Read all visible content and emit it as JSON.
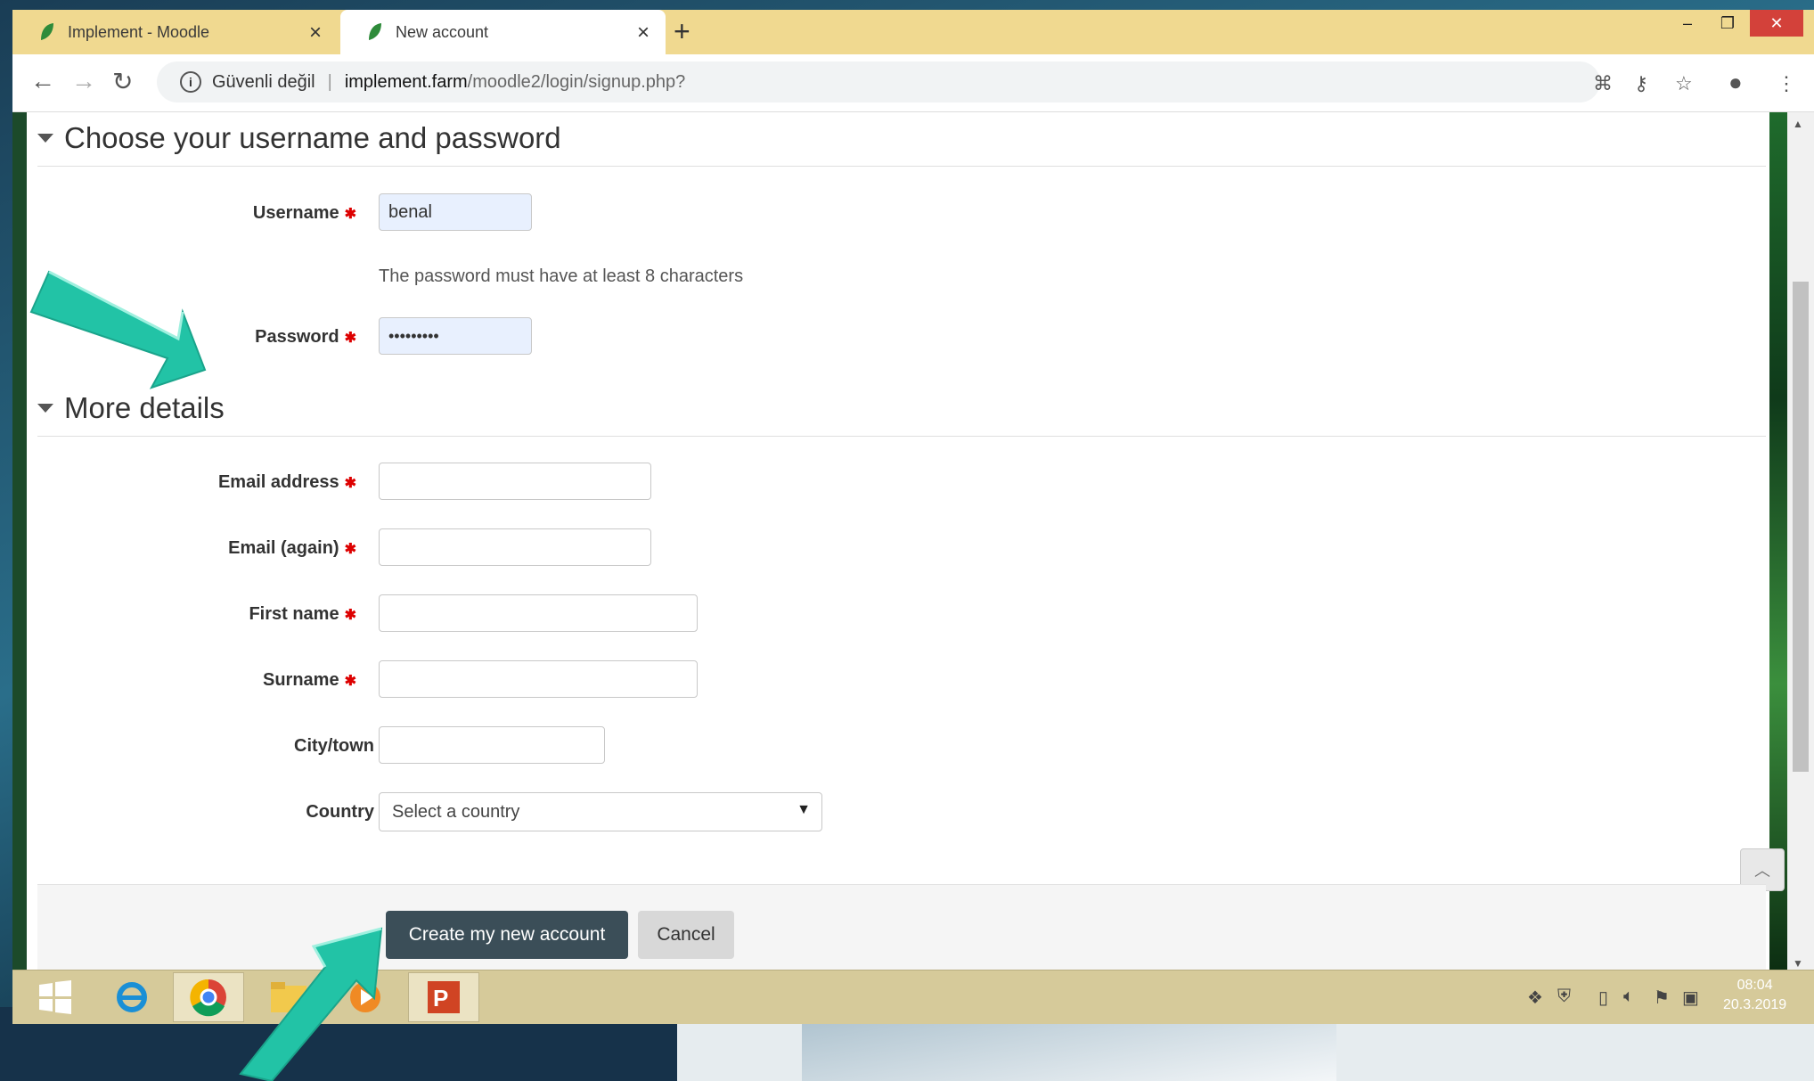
{
  "browser": {
    "tabs": [
      {
        "label": "Implement - Moodle"
      },
      {
        "label": "New account"
      }
    ],
    "address": {
      "security": "Güvenli değil",
      "host": "implement.farm",
      "path": "/moodle2/login/signup.php?"
    }
  },
  "form": {
    "section1_title": "Choose your username and password",
    "username_label": "Username",
    "username_value": "benal",
    "password_hint": "The password must have at least 8 characters",
    "password_label": "Password",
    "password_value": "•••••••••",
    "section2_title": "More details",
    "email_label": "Email address",
    "email_again_label": "Email (again)",
    "firstname_label": "First name",
    "surname_label": "Surname",
    "city_label": "City/town",
    "country_label": "Country",
    "country_value": "Select a country",
    "create_button": "Create my new account",
    "cancel_button": "Cancel"
  },
  "taskbar": {
    "time": "08:04",
    "date": "20.3.2019"
  },
  "colors": {
    "accent": "#3b4e58",
    "tabbar": "#f0d990",
    "arrow": "#22c3a6"
  }
}
